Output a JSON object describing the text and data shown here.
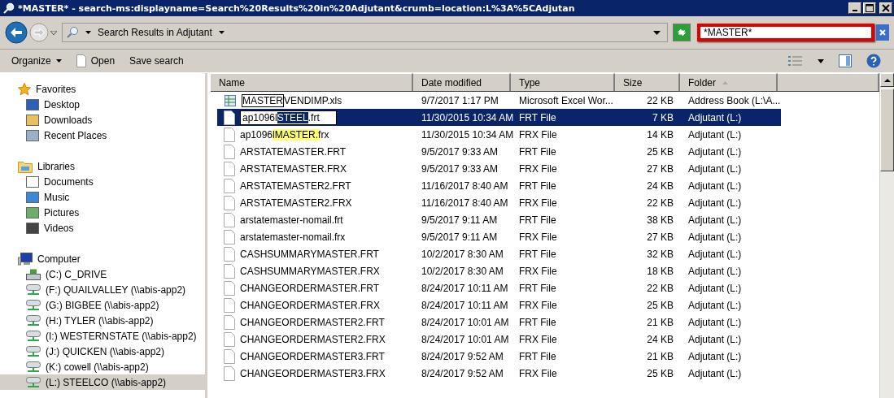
{
  "window": {
    "title": "*MASTER* - search-ms:displayname=Search%20Results%20in%20Adjutant&crumb=location:L%3A%5CAdjutan"
  },
  "address_bar": {
    "location": "Search Results in Adjutant"
  },
  "search": {
    "value": "*MASTER*"
  },
  "toolbar": {
    "organize": "Organize",
    "open": "Open",
    "save_search": "Save search"
  },
  "sidebar": {
    "groups": [
      {
        "label": "Favorites",
        "items": [
          {
            "label": "Desktop",
            "selected": false
          },
          {
            "label": "Downloads",
            "selected": false
          },
          {
            "label": "Recent Places",
            "selected": false
          }
        ]
      },
      {
        "label": "Libraries",
        "items": [
          {
            "label": "Documents",
            "selected": false
          },
          {
            "label": "Music",
            "selected": false
          },
          {
            "label": "Pictures",
            "selected": false
          },
          {
            "label": "Videos",
            "selected": false
          }
        ]
      },
      {
        "label": "Computer",
        "items": [
          {
            "label": "(C:) C_DRIVE",
            "selected": false,
            "kind": "local"
          },
          {
            "label": "(F:) QUAILVALLEY (\\\\abis-app2)",
            "selected": false,
            "kind": "network"
          },
          {
            "label": "(G:) BIGBEE (\\\\abis-app2)",
            "selected": false,
            "kind": "network"
          },
          {
            "label": "(H:) TYLER (\\\\abis-app2)",
            "selected": false,
            "kind": "network"
          },
          {
            "label": "(I:) WESTERNSTATE (\\\\abis-app2)",
            "selected": false,
            "kind": "network"
          },
          {
            "label": "(J:) QUICKEN (\\\\abis-app2)",
            "selected": false,
            "kind": "network"
          },
          {
            "label": "(K:) cowell (\\\\abis-app2)",
            "selected": false,
            "kind": "network"
          },
          {
            "label": "(L:) STEELCO (\\\\abis-app2)",
            "selected": true,
            "kind": "network"
          }
        ]
      }
    ]
  },
  "table": {
    "columns": [
      "Name",
      "Date modified",
      "Type",
      "Size",
      "Folder"
    ],
    "rows": [
      {
        "kind": "spreadsheet",
        "selected": false,
        "segments": [
          {
            "text": "MASTER",
            "highlighted": true
          },
          {
            "text": "VENDIMP.xls",
            "highlighted": false
          }
        ],
        "date": "9/7/2017 1:17 PM",
        "type": "Microsoft Excel Wor...",
        "size": "22 KB",
        "folder": "Address Book (L:\\A..."
      },
      {
        "kind": "renaming",
        "selected": true,
        "segments": [
          {
            "text": "ap1096l",
            "highlighted": false
          },
          {
            "text": "STEEL",
            "highlighted": true
          },
          {
            "text": ".frt",
            "highlighted": false
          }
        ],
        "date": "11/30/2015 10:34 AM",
        "type": "FRT File",
        "size": "7 KB",
        "folder": "Adjutant (L:)"
      },
      {
        "kind": "file",
        "selected": false,
        "segments": [
          {
            "text": "ap1096",
            "highlighted": false
          },
          {
            "text": "lMASTER.f",
            "highlighted": true
          },
          {
            "text": "rx",
            "highlighted": false
          }
        ],
        "date": "11/30/2015 10:34 AM",
        "type": "FRX File",
        "size": "14 KB",
        "folder": "Adjutant (L:)"
      },
      {
        "kind": "file",
        "selected": false,
        "name": "ARSTATEMASTER.FRT",
        "date": "9/5/2017 9:33 AM",
        "type": "FRT File",
        "size": "25 KB",
        "folder": "Adjutant (L:)"
      },
      {
        "kind": "file",
        "selected": false,
        "name": "ARSTATEMASTER.FRX",
        "date": "9/5/2017 9:33 AM",
        "type": "FRX File",
        "size": "27 KB",
        "folder": "Adjutant (L:)"
      },
      {
        "kind": "file",
        "selected": false,
        "name": "ARSTATEMASTER2.FRT",
        "date": "11/16/2017 8:40 AM",
        "type": "FRT File",
        "size": "24 KB",
        "folder": "Adjutant (L:)"
      },
      {
        "kind": "file",
        "selected": false,
        "name": "ARSTATEMASTER2.FRX",
        "date": "11/16/2017 8:40 AM",
        "type": "FRX File",
        "size": "22 KB",
        "folder": "Adjutant (L:)"
      },
      {
        "kind": "file",
        "selected": false,
        "name": "arstatemaster-nomail.frt",
        "date": "9/5/2017 9:11 AM",
        "type": "FRT File",
        "size": "38 KB",
        "folder": "Adjutant (L:)"
      },
      {
        "kind": "file",
        "selected": false,
        "name": "arstatemaster-nomail.frx",
        "date": "9/5/2017 9:11 AM",
        "type": "FRX File",
        "size": "27 KB",
        "folder": "Adjutant (L:)"
      },
      {
        "kind": "file",
        "selected": false,
        "name": "CASHSUMMARYMASTER.FRT",
        "date": "10/2/2017 8:30 AM",
        "type": "FRT File",
        "size": "32 KB",
        "folder": "Adjutant (L:)"
      },
      {
        "kind": "file",
        "selected": false,
        "name": "CASHSUMMARYMASTER.FRX",
        "date": "10/2/2017 8:30 AM",
        "type": "FRX File",
        "size": "18 KB",
        "folder": "Adjutant (L:)"
      },
      {
        "kind": "file",
        "selected": false,
        "name": "CHANGEORDERMASTER.FRT",
        "date": "8/24/2017 10:11 AM",
        "type": "FRT File",
        "size": "22 KB",
        "folder": "Adjutant (L:)"
      },
      {
        "kind": "file",
        "selected": false,
        "name": "CHANGEORDERMASTER.FRX",
        "date": "8/24/2017 10:11 AM",
        "type": "FRX File",
        "size": "25 KB",
        "folder": "Adjutant (L:)"
      },
      {
        "kind": "file",
        "selected": false,
        "name": "CHANGEORDERMASTER2.FRT",
        "date": "8/24/2017 10:01 AM",
        "type": "FRT File",
        "size": "21 KB",
        "folder": "Adjutant (L:)"
      },
      {
        "kind": "file",
        "selected": false,
        "name": "CHANGEORDERMASTER2.FRX",
        "date": "8/24/2017 10:01 AM",
        "type": "FRX File",
        "size": "24 KB",
        "folder": "Adjutant (L:)"
      },
      {
        "kind": "file",
        "selected": false,
        "name": "CHANGEORDERMASTER3.FRT",
        "date": "8/24/2017 9:52 AM",
        "type": "FRT File",
        "size": "21 KB",
        "folder": "Adjutant (L:)"
      },
      {
        "kind": "file",
        "selected": false,
        "name": "CHANGEORDERMASTER3.FRX",
        "date": "8/24/2017 9:52 AM",
        "type": "FRX File",
        "size": "25 KB",
        "folder": "Adjutant (L:)"
      }
    ]
  }
}
